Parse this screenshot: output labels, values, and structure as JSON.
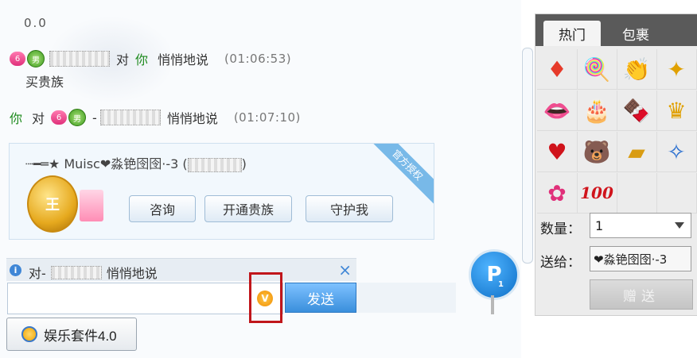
{
  "chat": {
    "zero_text": "0.0",
    "msg1": {
      "to_word": "对",
      "you": "你",
      "action": "悄悄地说",
      "time": "(01:06:53)"
    },
    "msg1_content": "买贵族",
    "msg2": {
      "you": "你",
      "to_word": "对",
      "dash": "-",
      "action": "悄悄地说",
      "time": "(01:07:10)"
    }
  },
  "badges": {
    "pink": "6",
    "green": "男"
  },
  "card": {
    "title": "┈━═★ Muisc❤淼铯囹囹·-3",
    "title_paren_open": "(",
    "title_paren_close": ")",
    "ribbon": "官方授权",
    "king_glyph": "王",
    "buttons": [
      {
        "label": "咨询"
      },
      {
        "label": "开通贵族"
      },
      {
        "label": "守护我"
      }
    ]
  },
  "whisper": {
    "prefix": "对-",
    "action": "悄悄地说",
    "close": "×",
    "info_glyph": "i"
  },
  "input": {
    "value": "",
    "vip_glyph": "V",
    "send_label": "发送"
  },
  "suite": {
    "label": "娱乐套件4.0"
  },
  "parking": {
    "glyph": "P",
    "count": "1"
  },
  "gift_panel": {
    "tabs": [
      {
        "label": "热门"
      },
      {
        "label": "包裹"
      }
    ],
    "gifts": [
      {
        "icon": "heart-card-icon",
        "glyph": "♦"
      },
      {
        "icon": "lollipop-icon",
        "glyph": "🍭"
      },
      {
        "icon": "clapping-hands-icon",
        "glyph": "👏"
      },
      {
        "icon": "magic-wand-icon",
        "glyph": "✦"
      },
      {
        "icon": "lips-icon",
        "glyph": "👄"
      },
      {
        "icon": "cake-icon",
        "glyph": "🎂"
      },
      {
        "icon": "chocolate-icon",
        "glyph": "🍫"
      },
      {
        "icon": "crown-icon",
        "glyph": "♛"
      },
      {
        "icon": "heart-arrow-icon",
        "glyph": "♥"
      },
      {
        "icon": "teddy-bear-icon",
        "glyph": "🐻"
      },
      {
        "icon": "gold-bar-icon",
        "glyph": "▰"
      },
      {
        "icon": "fairy-wand-icon",
        "glyph": "✧"
      },
      {
        "icon": "pink-badge-icon",
        "glyph": "✿"
      },
      {
        "icon": "score-100-icon",
        "glyph": "100"
      }
    ],
    "qty_label": "数量：",
    "qty_value": "1",
    "to_label": "送给：",
    "to_value": "❤淼铯囹囹·-3",
    "give_label": "赠送"
  },
  "colors": {
    "accent_blue": "#3a8fdc",
    "green_text": "#1d8a1d",
    "highlight_red": "#c0161b"
  }
}
